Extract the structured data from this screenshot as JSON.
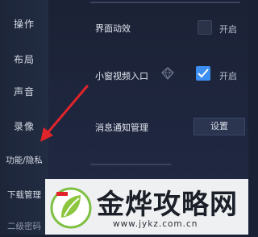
{
  "sidebar": {
    "items": [
      {
        "label": "操作"
      },
      {
        "label": "布局"
      },
      {
        "label": "声音"
      },
      {
        "label": "录像"
      },
      {
        "label": "功能/隐私"
      },
      {
        "label": "下载管理"
      },
      {
        "label": "二级密码"
      }
    ]
  },
  "settings": {
    "interface_animation": {
      "label": "界面动效",
      "option_label": "开启",
      "checked": false
    },
    "mini_video_entry": {
      "label": "小窗视频入口",
      "option_label": "开启",
      "checked": true
    },
    "notification_management": {
      "label": "消息通知管理",
      "button_label": "设置"
    }
  },
  "watermark": {
    "title": "金烨攻略网",
    "url": "www.jykz.com.cn"
  },
  "colors": {
    "background": "#1a2135",
    "accent": "#3c8ef0",
    "arrow": "#e0242a"
  }
}
